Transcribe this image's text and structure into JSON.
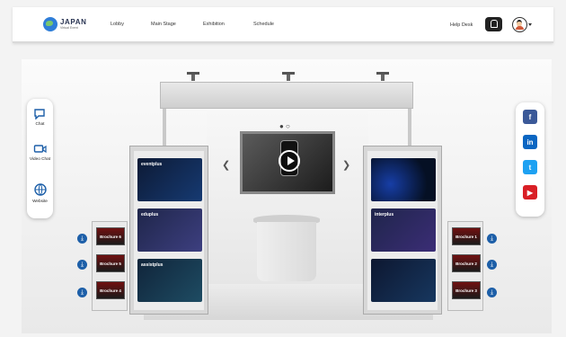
{
  "header": {
    "logo_main": "JAPAN",
    "logo_sub": "Virtual Event",
    "nav": [
      "Lobby",
      "Main Stage",
      "Exhibition",
      "Schedule"
    ],
    "help_desk": "Help Desk"
  },
  "booth": {
    "left_panel_cards": [
      {
        "label": "eventplus"
      },
      {
        "label": "eduplus"
      },
      {
        "label": "assistplus"
      }
    ],
    "right_panel_cards": [
      {
        "label": ""
      },
      {
        "label": "interplus"
      },
      {
        "label": ""
      }
    ]
  },
  "left_sidebar": {
    "items": [
      {
        "label": "Chat",
        "icon": "chat-icon"
      },
      {
        "label": "Video Chat",
        "icon": "video-icon"
      },
      {
        "label": "Website",
        "icon": "globe-icon"
      }
    ]
  },
  "social": {
    "items": [
      "facebook",
      "linkedin",
      "twitter",
      "youtube"
    ]
  },
  "brochures_left": [
    "Brochure 6",
    "Brochure 5",
    "Brochure 4"
  ],
  "brochures_right": [
    "Brochure 1",
    "Brochure 2",
    "Brochure 3"
  ],
  "colors": {
    "facebook": "#3b5998",
    "linkedin": "#0a66c2",
    "twitter": "#1da1f2",
    "youtube": "#d91f26"
  }
}
